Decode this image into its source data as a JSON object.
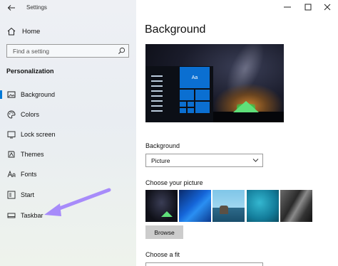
{
  "window": {
    "title": "Settings",
    "controls": [
      "minimize-icon",
      "maximize-icon",
      "close-icon"
    ]
  },
  "sidebar": {
    "home_label": "Home",
    "search_placeholder": "Find a setting",
    "section_title": "Personalization",
    "items": [
      {
        "label": "Background",
        "icon": "background-icon",
        "active": true
      },
      {
        "label": "Colors",
        "icon": "palette-icon",
        "active": false
      },
      {
        "label": "Lock screen",
        "icon": "lock-screen-icon",
        "active": false
      },
      {
        "label": "Themes",
        "icon": "themes-icon",
        "active": false
      },
      {
        "label": "Fonts",
        "icon": "fonts-icon",
        "active": false
      },
      {
        "label": "Start",
        "icon": "start-icon",
        "active": false
      },
      {
        "label": "Taskbar",
        "icon": "taskbar-icon",
        "active": false
      }
    ],
    "accent_color": "#0078d7",
    "annotation_arrow_color": "#a78bfa"
  },
  "main": {
    "title": "Background",
    "preview_tile_label": "Aa",
    "background_label": "Background",
    "background_value": "Picture",
    "choose_picture_label": "Choose your picture",
    "browse_label": "Browse",
    "choose_fit_label": "Choose a fit"
  }
}
